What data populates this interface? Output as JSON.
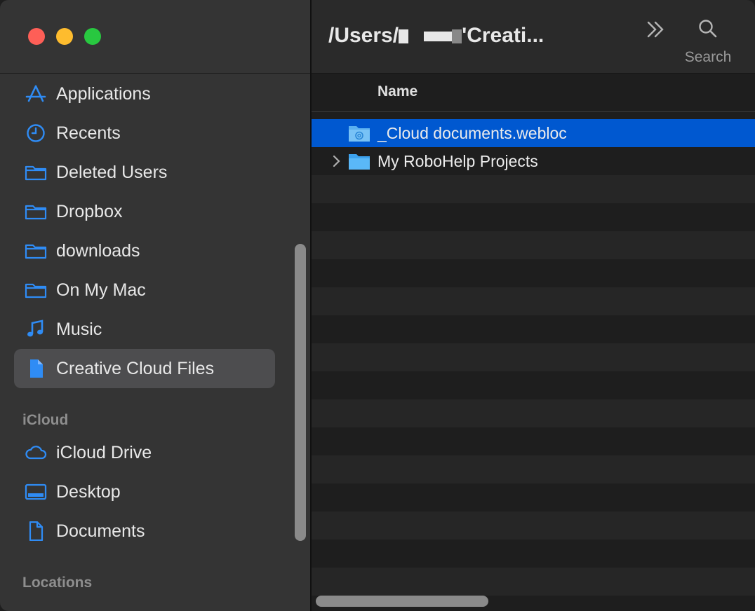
{
  "window": {
    "title_parts": [
      "/Users/",
      "'Creati..."
    ]
  },
  "toolbar": {
    "search_label": "Search"
  },
  "sidebar": {
    "favorites": [
      {
        "label": "Applications",
        "icon": "applications-icon"
      },
      {
        "label": "Recents",
        "icon": "clock-icon"
      },
      {
        "label": "Deleted Users",
        "icon": "folder-icon"
      },
      {
        "label": "Dropbox",
        "icon": "folder-icon"
      },
      {
        "label": "downloads",
        "icon": "folder-icon"
      },
      {
        "label": "On My Mac",
        "icon": "folder-icon"
      },
      {
        "label": "Music",
        "icon": "music-note-icon"
      },
      {
        "label": "Creative Cloud Files",
        "icon": "document-icon",
        "selected": true
      }
    ],
    "icloud_header": "iCloud",
    "icloud": [
      {
        "label": "iCloud Drive",
        "icon": "cloud-icon"
      },
      {
        "label": "Desktop",
        "icon": "desktop-icon"
      },
      {
        "label": "Documents",
        "icon": "document-outline-icon"
      }
    ],
    "locations_header": "Locations"
  },
  "list": {
    "column_name": "Name",
    "items": [
      {
        "label": "_Cloud documents.webloc",
        "selected": true,
        "kind": "webloc"
      },
      {
        "label": "My RoboHelp Projects",
        "selected": false,
        "kind": "folder",
        "expandable": true
      }
    ]
  },
  "colors": {
    "accent": "#0058d0",
    "sidebar_icon": "#2f8cf5"
  }
}
